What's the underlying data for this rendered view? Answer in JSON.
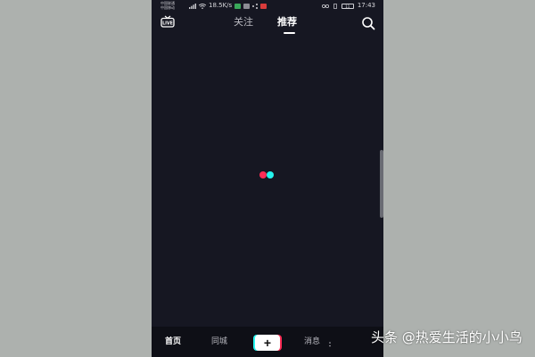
{
  "status_bar": {
    "carrier_1": "中国联通",
    "carrier_2": "中国移动",
    "net_speed": "18.5K/s",
    "battery": "11",
    "time": "17:43"
  },
  "top_nav": {
    "live_label": "LIVE",
    "tabs": [
      {
        "label": "关注",
        "active": false
      },
      {
        "label": "推荐",
        "active": true
      }
    ],
    "search_icon": "search-icon"
  },
  "content": {
    "loading_colors": [
      "#fe2c55",
      "#25f4ee"
    ]
  },
  "bottom_nav": {
    "items": [
      {
        "label": "首页",
        "active": true
      },
      {
        "label": "同城",
        "active": false
      },
      {
        "label": "+",
        "active": false
      },
      {
        "label": "消息",
        "active": false
      }
    ]
  },
  "watermark": {
    "text": "头条 @热爱生活的小小鸟"
  },
  "colors": {
    "background": "#161722",
    "accent_red": "#fe2c55",
    "accent_cyan": "#25f4ee"
  }
}
